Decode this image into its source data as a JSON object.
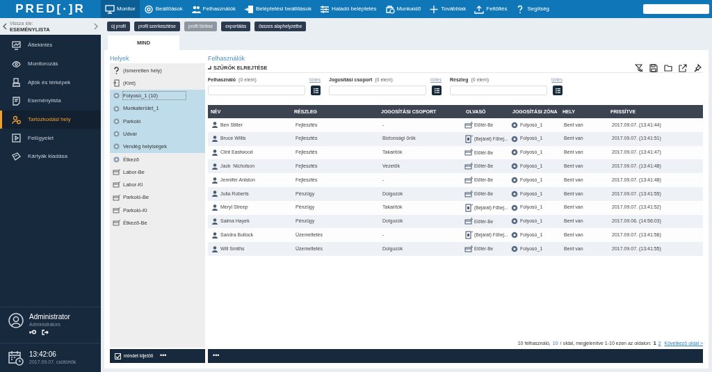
{
  "logo": "PRED[·]R",
  "top_nav": [
    {
      "label": "Monitor",
      "selected": true
    },
    {
      "label": "Beállítások",
      "selected": false
    },
    {
      "label": "Felhasználók",
      "selected": false
    },
    {
      "label": "Beléptetési beállítások",
      "selected": false
    },
    {
      "label": "Haladó beléptetés",
      "selected": false
    },
    {
      "label": "Munkaidő",
      "selected": false
    },
    {
      "label": "Továbbiak",
      "selected": false
    },
    {
      "label": "Feltöltés",
      "selected": false
    },
    {
      "label": "Segítség",
      "selected": false
    }
  ],
  "back": {
    "caption": "Vissza ide:",
    "target": "ESEMÉNYLISTA"
  },
  "sidebar": [
    {
      "label": "Áttekintés",
      "selected": false
    },
    {
      "label": "Monitorozás",
      "selected": false
    },
    {
      "label": "Ajtók és térképek",
      "selected": false
    },
    {
      "label": "Eseménylista",
      "selected": false
    },
    {
      "label": "Tartózkodási hely",
      "selected": true
    },
    {
      "label": "Felügyelet",
      "selected": false
    },
    {
      "label": "Kártyák kiadása",
      "selected": false
    }
  ],
  "user": {
    "name": "Administrator",
    "role": "Administrators"
  },
  "clock": {
    "time": "13:42:06",
    "date": "2017.09.07. csütörtök"
  },
  "toolbar": [
    {
      "label": "új profil",
      "disabled": false
    },
    {
      "label": "profil szerkesztése",
      "disabled": false
    },
    {
      "label": "profil törlése",
      "disabled": true
    },
    {
      "label": "exportálás",
      "disabled": false
    },
    {
      "label": "összes alaphelyzetbe",
      "disabled": false
    }
  ],
  "tabs": [
    {
      "label": "MIND",
      "selected": true
    }
  ],
  "places": {
    "title": "Helyek",
    "items": [
      {
        "label": "(Ismeretlen hely)",
        "kind": "unknown",
        "selected": false,
        "focused": false
      },
      {
        "label": "(Kint)",
        "kind": "outside",
        "selected": false,
        "focused": false
      },
      {
        "label": "Folyosó_1 (10)",
        "kind": "zone",
        "selected": true,
        "focused": true
      },
      {
        "label": "Munkaterület_1",
        "kind": "zone",
        "selected": true,
        "focused": false
      },
      {
        "label": "Parkoló",
        "kind": "zone",
        "selected": true,
        "focused": false
      },
      {
        "label": "Udvar",
        "kind": "zone",
        "selected": true,
        "focused": false
      },
      {
        "label": "Vendég helyiségek",
        "kind": "zone",
        "selected": true,
        "focused": false
      },
      {
        "label": "Étkező",
        "kind": "zone",
        "selected": false,
        "focused": false
      },
      {
        "label": "Labor-Be",
        "kind": "reader",
        "selected": false,
        "focused": false
      },
      {
        "label": "Labor-Ki",
        "kind": "reader",
        "selected": false,
        "focused": false
      },
      {
        "label": "Parkoló-Be",
        "kind": "reader",
        "selected": false,
        "focused": false
      },
      {
        "label": "Parkoló-Ki",
        "kind": "reader",
        "selected": false,
        "focused": false
      },
      {
        "label": "Étkező-Be",
        "kind": "reader",
        "selected": false,
        "focused": false
      }
    ],
    "select_all": {
      "label": "mindet kijelöli",
      "checked": true
    },
    "more": "•••"
  },
  "users": {
    "title": "Felhasználók",
    "filters_toggle": "SZŰRŐK ELREJTÉSE",
    "filters": [
      {
        "label": "Felhasználó",
        "count": "(0 elem)",
        "clear": "törlés"
      },
      {
        "label": "Jogosítási csoport",
        "count": "(0 elem)",
        "clear": "törlés"
      },
      {
        "label": "Részleg",
        "count": "(0 elem)",
        "clear": "törlés"
      }
    ],
    "columns": [
      "NÉV",
      "RÉSZLEG",
      "JOGOSÍTÁSI CSOPORT",
      "OLVASÓ",
      "JOGOSÍTÁSI ZÓNA",
      "HELY",
      "FRISSÍTVE"
    ],
    "rows": [
      {
        "name": "Ben Stiller",
        "dept": "Fejlesztés",
        "group": "-",
        "kind": "card",
        "reader": "Előtér-Be",
        "zone": "Folyosó_1",
        "place": "Bent van",
        "updated": "2017.09.07. (13:41:44)"
      },
      {
        "name": "Bruce Willis",
        "dept": "Fejlesztés",
        "group": "Biztonsági őrök",
        "kind": "door",
        "reader": "(Bejárat) Főbej...",
        "zone": "Folyosó_1",
        "place": "Bent van",
        "updated": "2017.09.07. (13:41:51)"
      },
      {
        "name": "Clint Eastwood",
        "dept": "Fejlesztés",
        "group": "Takarítók",
        "kind": "card",
        "reader": "Előtér-Be",
        "zone": "Folyosó_1",
        "place": "Bent van",
        "updated": "2017.09.07. (13:41:47)"
      },
      {
        "name": "Jack  Nicholson",
        "dept": "Fejlesztés",
        "group": "Vezetők",
        "kind": "card",
        "reader": "Előtér-Be",
        "zone": "Folyosó_1",
        "place": "Bent van",
        "updated": "2017.09.07. (13:41:48)"
      },
      {
        "name": "Jennifer Aniston",
        "dept": "Fejlesztés",
        "group": "-",
        "kind": "card",
        "reader": "Előtér-Be",
        "zone": "Folyosó_1",
        "place": "Bent van",
        "updated": "2017.09.07. (13:41:48)"
      },
      {
        "name": "Julia Roberts",
        "dept": "Pénzügy",
        "group": "Dolgozók",
        "kind": "card",
        "reader": "Előtér-Be",
        "zone": "Folyosó_1",
        "place": "Bent van",
        "updated": "2017.09.07. (13:41:55)"
      },
      {
        "name": "Meryl Streep",
        "dept": "Pénzügy",
        "group": "Takarítók",
        "kind": "door",
        "reader": "(Bejárat) Főbej...",
        "zone": "Folyosó_1",
        "place": "Bent van",
        "updated": "2017.09.07. (13:41:52)"
      },
      {
        "name": "Salma Hayek",
        "dept": "Pénzügy",
        "group": "Dolgozók",
        "kind": "card",
        "reader": "Előtér-Be",
        "zone": "Folyosó_1",
        "place": "Bent van",
        "updated": "2017.09.06. (14:56:03)"
      },
      {
        "name": "Sandra Bullock",
        "dept": "Üzemeltetés",
        "group": "-",
        "kind": "door",
        "reader": "(Bejárat) Főbej...",
        "zone": "Folyosó_1",
        "place": "Bent van",
        "updated": "2017.09.07. (13:41:56)"
      },
      {
        "name": "Will Smiths",
        "dept": "Üzemeltetés",
        "group": "Dolgozók",
        "kind": "card",
        "reader": "Előtér-Be",
        "zone": "Folyosó_1",
        "place": "Bent van",
        "updated": "2017.09.07. (13:41:55)"
      }
    ],
    "pager": {
      "total": "10  felhasználó,",
      "per_page": "10",
      "per_page_suffix": "/ oldal, megjelenítve 1-10 ezen az oldalon:",
      "pages": [
        {
          "label": "1",
          "selected": true
        },
        {
          "label": "2",
          "selected": false
        }
      ],
      "next": "Következő oldal >"
    },
    "more": "•••"
  }
}
